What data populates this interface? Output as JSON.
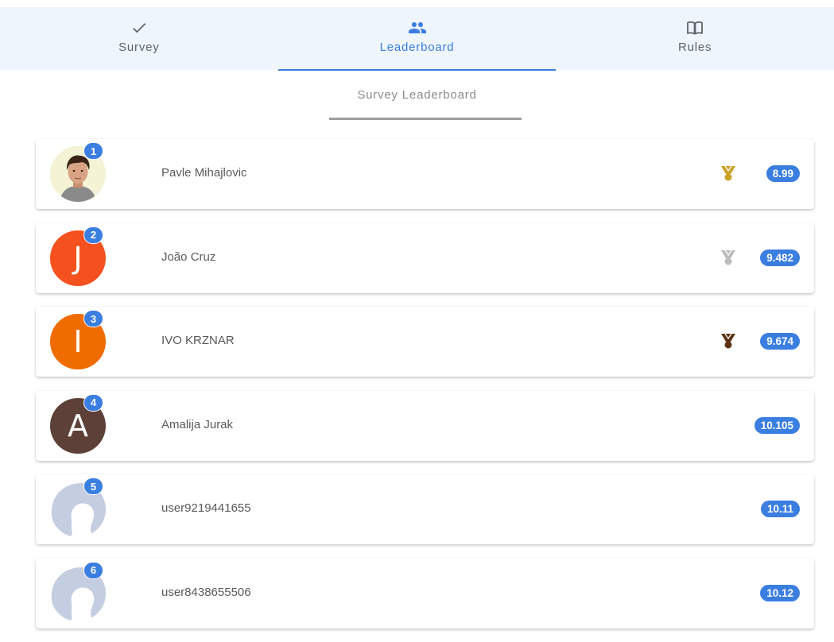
{
  "tabs": [
    {
      "label": "Survey",
      "icon": "check-icon"
    },
    {
      "label": "Leaderboard",
      "icon": "people-icon",
      "active": true
    },
    {
      "label": "Rules",
      "icon": "book-icon"
    }
  ],
  "subtitle": "Survey Leaderboard",
  "colors": {
    "accent": "#3a7ee0",
    "tabbar_bg": "#eef5fd",
    "gold": "#c9a227",
    "silver": "#bdbdbd",
    "bronze": "#5d3312"
  },
  "entries": [
    {
      "rank": "1",
      "name": "Pavle Mihajlovic",
      "score": "8.99",
      "avatar": "photo",
      "medal": "gold-medal-icon"
    },
    {
      "rank": "2",
      "name": "João Cruz",
      "score": "9.482",
      "avatar_letter": "J",
      "avatar_color": "#f4511e",
      "medal": "silver-medal-icon"
    },
    {
      "rank": "3",
      "name": "IVO KRZNAR",
      "score": "9.674",
      "avatar_letter": "I",
      "avatar_color": "#ef6c00",
      "medal": "bronze-medal-icon"
    },
    {
      "rank": "4",
      "name": "Amalija Jurak",
      "score": "10.105",
      "avatar_letter": "A",
      "avatar_color": "#5d4037"
    },
    {
      "rank": "5",
      "name": "user9219441655",
      "score": "10.11",
      "avatar": "placeholder"
    },
    {
      "rank": "6",
      "name": "user8438655506",
      "score": "10.12",
      "avatar": "placeholder"
    }
  ]
}
